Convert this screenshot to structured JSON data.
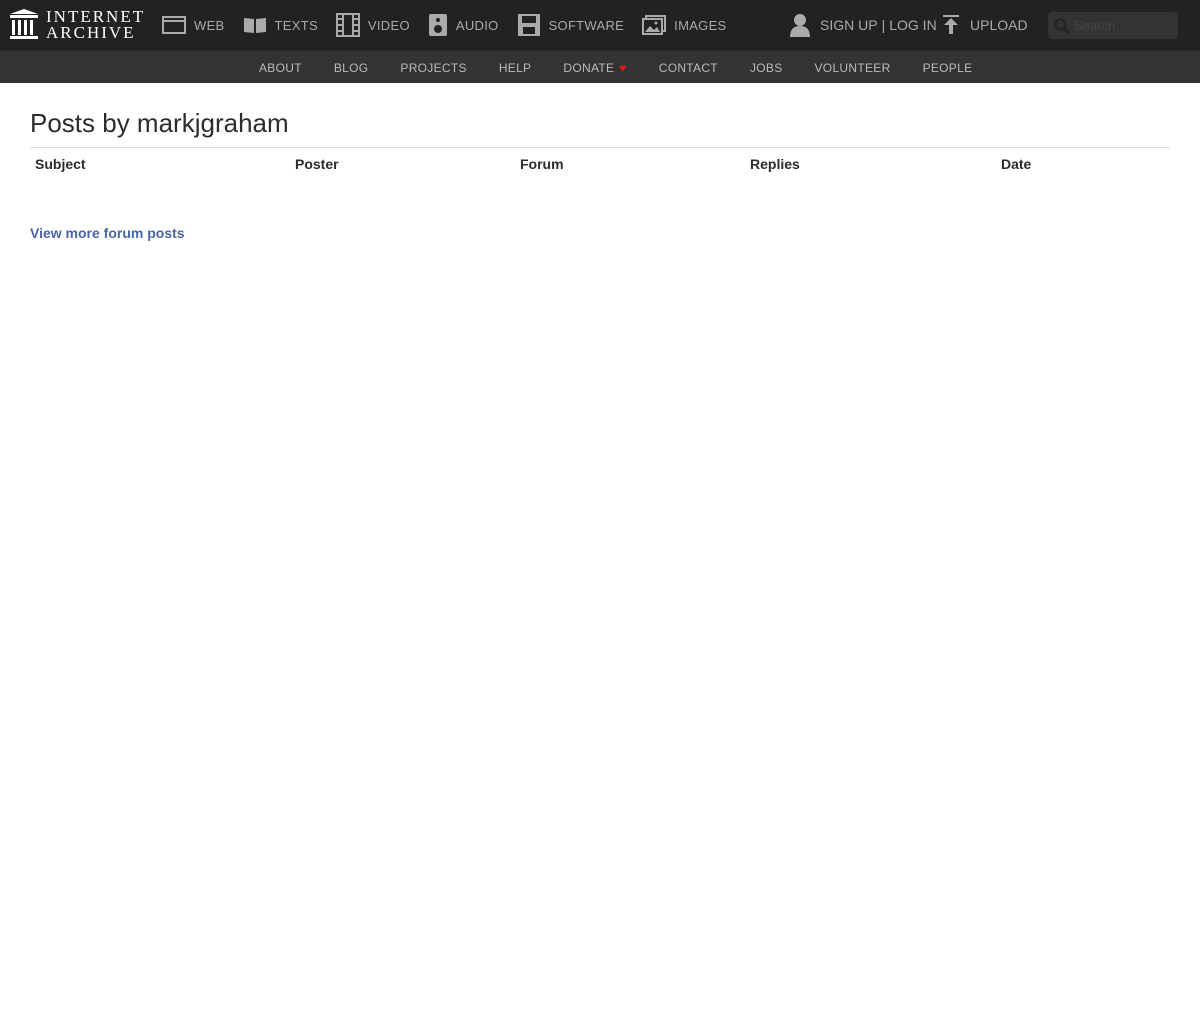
{
  "brand": {
    "line1": "INTERNET",
    "line2": "ARCHIVE"
  },
  "media_nav": [
    {
      "label": "WEB",
      "icon": "web-icon"
    },
    {
      "label": "TEXTS",
      "icon": "book-icon"
    },
    {
      "label": "VIDEO",
      "icon": "film-icon"
    },
    {
      "label": "AUDIO",
      "icon": "speaker-icon"
    },
    {
      "label": "SOFTWARE",
      "icon": "floppy-icon"
    },
    {
      "label": "IMAGES",
      "icon": "image-icon"
    }
  ],
  "user": {
    "signup": "SIGN UP",
    "separator": "|",
    "login": "LOG IN",
    "icon": "user-icon"
  },
  "upload": {
    "label": "UPLOAD",
    "icon": "upload-icon"
  },
  "search": {
    "placeholder": "Search"
  },
  "sub_nav": [
    "ABOUT",
    "BLOG",
    "PROJECTS",
    "HELP",
    "DONATE",
    "CONTACT",
    "JOBS",
    "VOLUNTEER",
    "PEOPLE"
  ],
  "page": {
    "title": "Posts by markjgraham",
    "columns": [
      "Subject",
      "Poster",
      "Forum",
      "Replies",
      "Date"
    ],
    "view_more": "View more forum posts"
  },
  "colors": {
    "topbar": "#222222",
    "subbar": "#333333",
    "link": "#4b64a8",
    "heart": "#e31818"
  }
}
